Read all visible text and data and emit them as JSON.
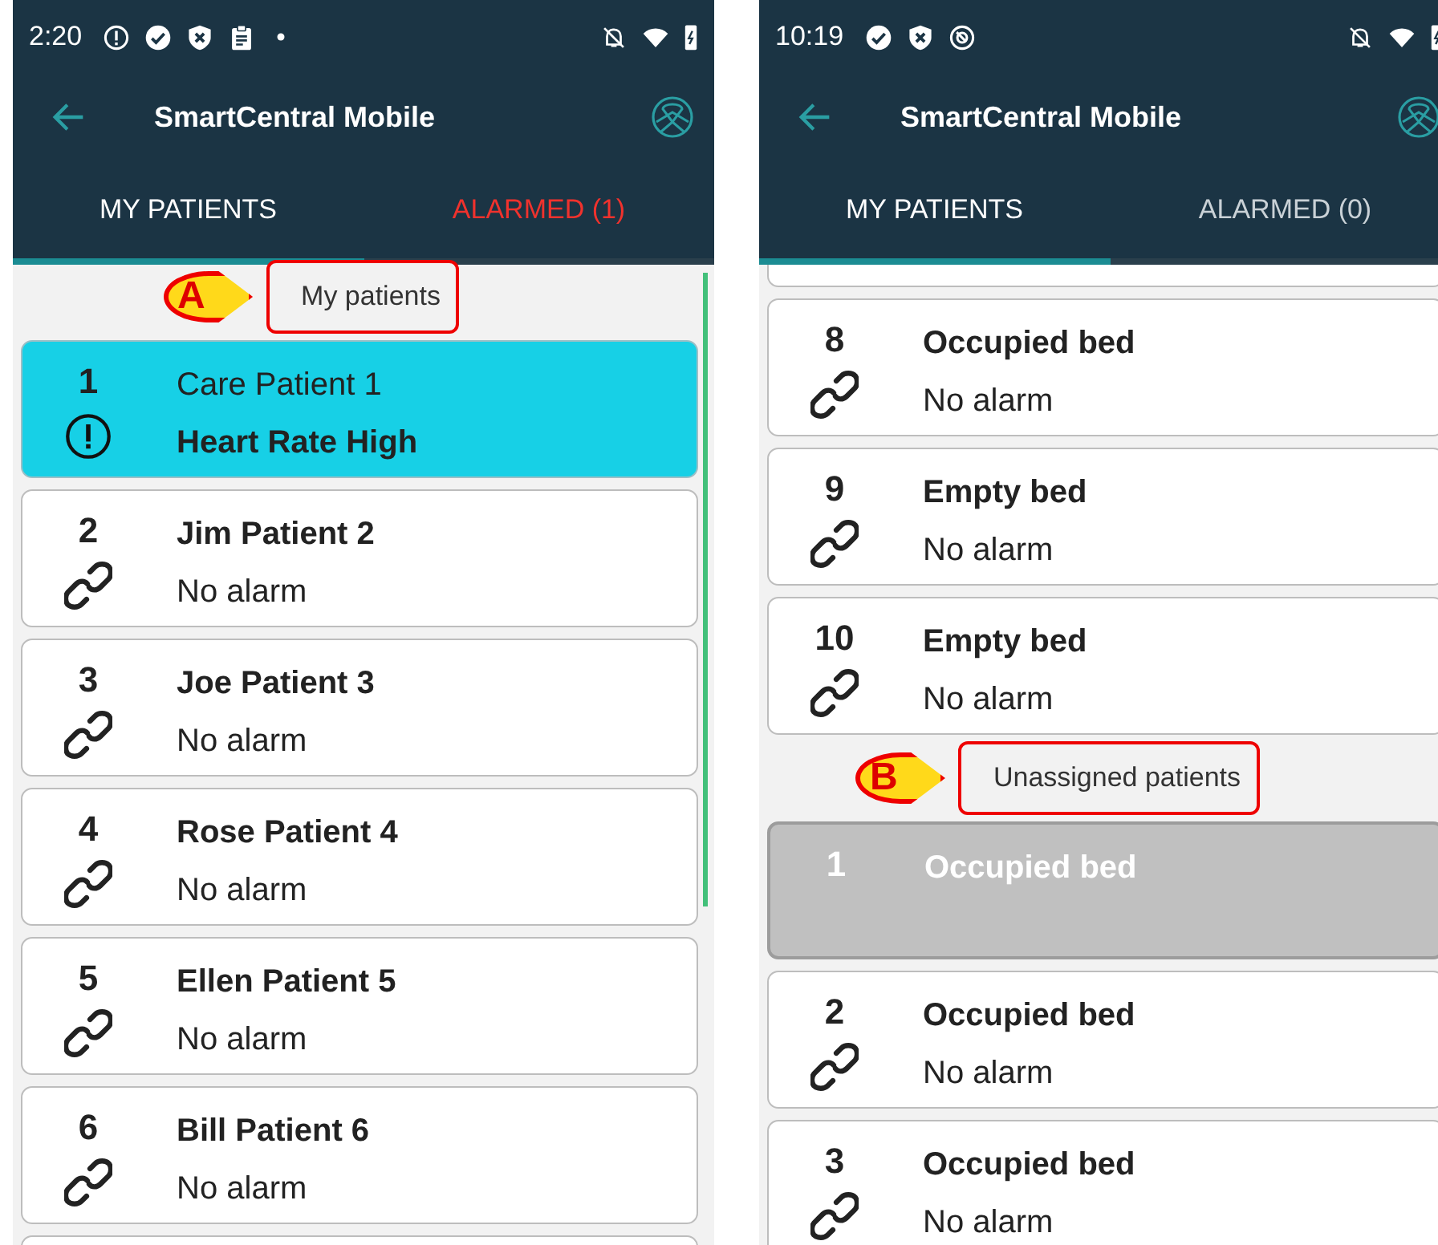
{
  "phones": [
    {
      "status_bar": {
        "time": "2:20",
        "icons": [
          {
            "kind": "alert"
          },
          {
            "kind": "check"
          },
          {
            "kind": "shield"
          },
          {
            "kind": "clipboard"
          },
          {
            "kind": "dot"
          }
        ]
      },
      "title": "SmartCentral Mobile",
      "tabs": [
        {
          "label": "MY PATIENTS",
          "selected": true,
          "alert": false
        },
        {
          "label": "ALARMED (1)",
          "selected": false,
          "alert": true
        }
      ],
      "scrollbar": true,
      "items": [
        {
          "kind": "section",
          "label": "My patients",
          "callout": "A"
        },
        {
          "kind": "alarmed",
          "number": "1",
          "name": "Care Patient 1",
          "status": "Heart Rate High"
        },
        {
          "kind": "normal",
          "number": "2",
          "name": "Jim Patient 2",
          "status": "No alarm"
        },
        {
          "kind": "normal",
          "number": "3",
          "name": "Joe Patient 3",
          "status": "No alarm"
        },
        {
          "kind": "normal",
          "number": "4",
          "name": "Rose Patient 4",
          "status": "No alarm"
        },
        {
          "kind": "normal",
          "number": "5",
          "name": "Ellen Patient 5",
          "status": "No alarm"
        },
        {
          "kind": "normal",
          "number": "6",
          "name": "Bill Patient 6",
          "status": "No alarm"
        },
        {
          "kind": "clipped"
        }
      ]
    },
    {
      "status_bar": {
        "time": "10:19",
        "icons": [
          {
            "kind": "check"
          },
          {
            "kind": "shield"
          },
          {
            "kind": "at"
          }
        ]
      },
      "title": "SmartCentral Mobile",
      "tabs": [
        {
          "label": "MY PATIENTS",
          "selected": true,
          "alert": false
        },
        {
          "label": "ALARMED (0)",
          "selected": false,
          "alert": false
        }
      ],
      "scrollbar": false,
      "items": [
        {
          "kind": "clipped"
        },
        {
          "kind": "normal",
          "number": "8",
          "name": "Occupied bed",
          "status": "No alarm"
        },
        {
          "kind": "normal",
          "number": "9",
          "name": "Empty bed",
          "status": "No alarm"
        },
        {
          "kind": "normal",
          "number": "10",
          "name": "Empty bed",
          "status": "No alarm"
        },
        {
          "kind": "section",
          "label": "Unassigned patients",
          "callout": "B"
        },
        {
          "kind": "inactive",
          "number": "1",
          "name": "Occupied bed"
        },
        {
          "kind": "normal",
          "number": "2",
          "name": "Occupied bed",
          "status": "No alarm"
        },
        {
          "kind": "normal",
          "number": "3",
          "name": "Occupied bed",
          "status": "No alarm"
        }
      ]
    }
  ]
}
